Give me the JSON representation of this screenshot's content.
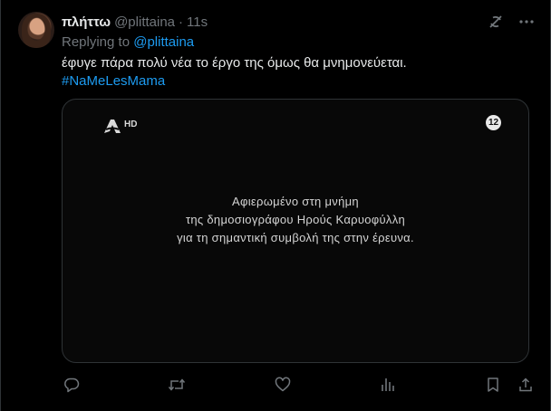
{
  "tweet": {
    "author_name": "πλήττω",
    "author_handle": "@plittaina",
    "separator": "·",
    "timestamp": "11s",
    "replying_prefix": "Replying to",
    "replying_to": "@plittaina",
    "text": "έφυγε πάρα πολύ νέα το έργο της όμως θα μνημονεύεται.",
    "hashtag": "#NaMeLesMama"
  },
  "media": {
    "channel_logo_suffix": "HD",
    "rating_badge": "12",
    "dedication_lines": [
      "Αφιερωμένο στη μνήμη",
      "της δημοσιογράφου Ηρούς Καρυοφύλλη",
      "για τη σημαντική συμβολή της στην έρευνα."
    ]
  },
  "icons": {
    "top": [
      "grok-icon",
      "more-icon"
    ],
    "actions": [
      "reply-icon",
      "retweet-icon",
      "like-icon",
      "views-icon",
      "bookmark-icon",
      "share-icon"
    ]
  },
  "colors": {
    "background": "#000000",
    "text_primary": "#e7e9ea",
    "text_secondary": "#71767b",
    "accent": "#1d9bf0",
    "border": "#2f3336"
  }
}
